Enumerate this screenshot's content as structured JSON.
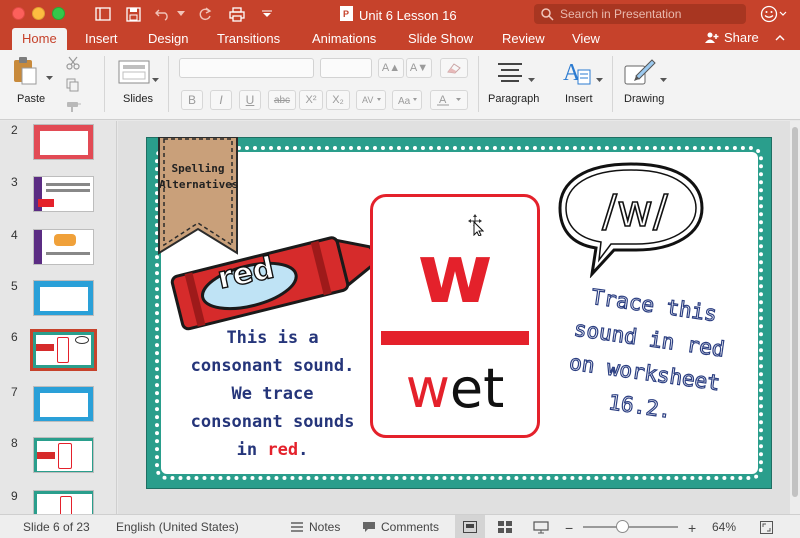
{
  "window": {
    "title": "Unit 6 Lesson 16",
    "search_placeholder": "Search in Presentation"
  },
  "ribbon": {
    "tabs": [
      "Home",
      "Insert",
      "Design",
      "Transitions",
      "Animations",
      "Slide Show",
      "Review",
      "View"
    ],
    "active_tab": "Home",
    "share_label": "Share",
    "groups": {
      "paste": "Paste",
      "slides": "Slides",
      "paragraph": "Paragraph",
      "insert": "Insert",
      "drawing": "Drawing"
    },
    "font_buttons": [
      "B",
      "I",
      "U",
      "abc",
      "X²",
      "X₂"
    ]
  },
  "thumbnails": {
    "numbers": [
      "2",
      "3",
      "4",
      "5",
      "6",
      "7",
      "8",
      "9"
    ],
    "selected_index": 4
  },
  "slide": {
    "tag_text_line1": "Spelling",
    "tag_text_line2": "Alternatives",
    "crayon_word": "red",
    "card_letter": "w",
    "card_word_first": "w",
    "card_word_rest": "et",
    "bubble_text": "/w/",
    "left_line1": "This is a",
    "left_line2": "consonant sound.",
    "left_line3": "We trace",
    "left_line4": "consonant sounds",
    "left_line5_prefix": "in",
    "left_line5_red": "red",
    "left_line5_suffix": ".",
    "right_line1": "Trace this",
    "right_line2": "sound in red",
    "right_line3": "on worksheet",
    "right_line4": "16.2."
  },
  "status": {
    "slide_position": "Slide 6 of 23",
    "language": "English (United States)",
    "notes_label": "Notes",
    "comments_label": "Comments",
    "zoom_minus": "−",
    "zoom_plus": "+",
    "zoom_level": "64%",
    "zoom_fraction": 0.42
  },
  "colors": {
    "accent": "#c6422b",
    "slide_border": "#2a9e8c",
    "card_red": "#e4212b",
    "text_blue": "#25357a"
  }
}
